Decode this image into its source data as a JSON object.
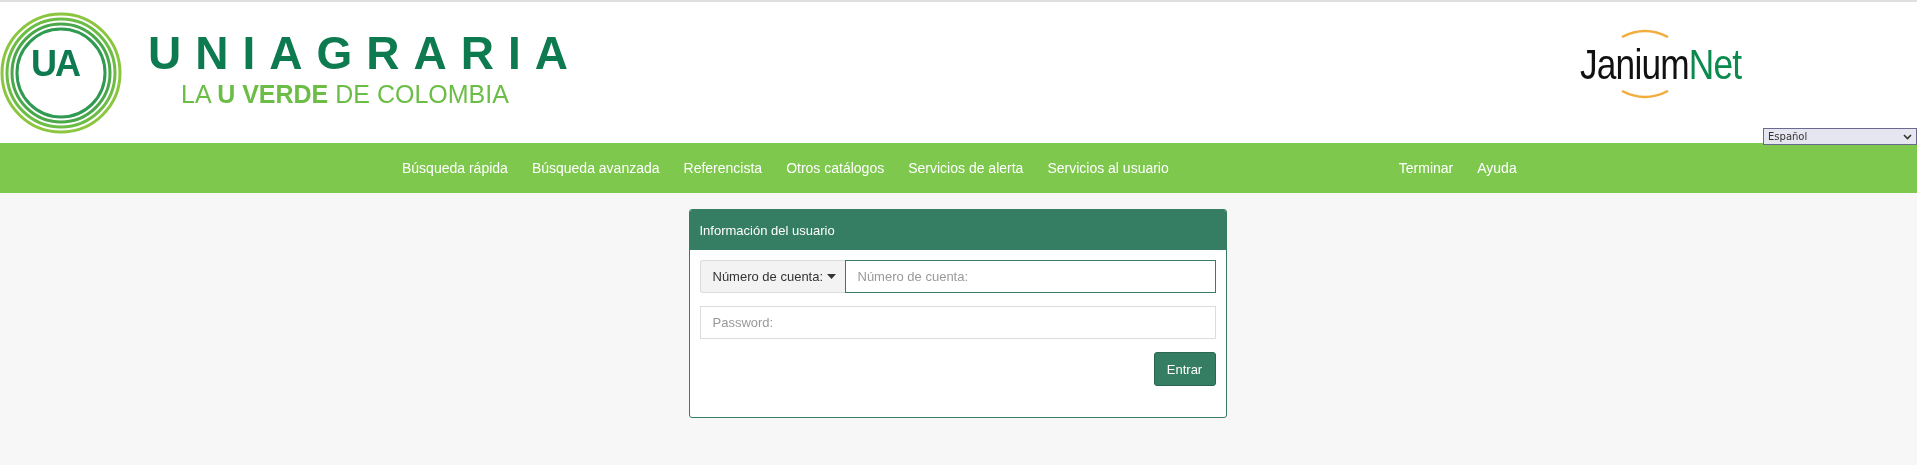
{
  "header": {
    "logo": {
      "badge": "UA",
      "name": "UNIAGRARIA",
      "tagline": "LA **U VERDE** DE COLOMBIA"
    },
    "partner_logo": {
      "dark_part": "Janium",
      "green_part": "Net"
    },
    "language": {
      "value": "Español"
    }
  },
  "nav": {
    "items": [
      {
        "label": "Búsqueda rápida"
      },
      {
        "label": "Búsqueda avanzada"
      },
      {
        "label": "Referencista"
      },
      {
        "label": "Otros catálogos"
      },
      {
        "label": "Servicios de alerta"
      },
      {
        "label": "Servicios al usuario"
      }
    ],
    "right_items": [
      {
        "label": "Terminar"
      },
      {
        "label": "Ayuda"
      }
    ]
  },
  "login": {
    "title": "Información del usuario",
    "account_type": "Número de cuenta:",
    "account_placeholder": "Número de cuenta:",
    "password_placeholder": "Password:",
    "submit": "Entrar"
  }
}
